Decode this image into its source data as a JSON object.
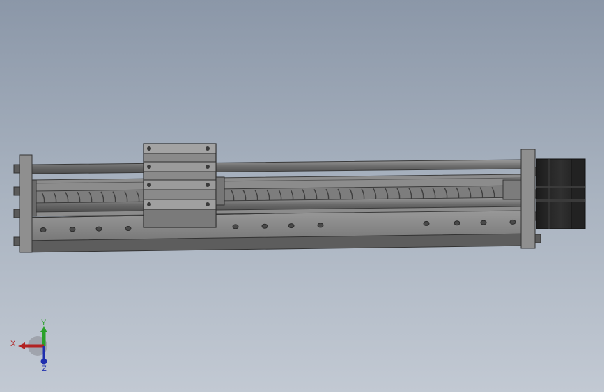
{
  "viewport": {
    "background_top": "#8b97a8",
    "background_bottom": "#c2c9d3"
  },
  "model": {
    "part_color": "#8e8e8e",
    "part_dark": "#4a4a4a",
    "motor_color": "#262626",
    "rod_color": "#7a7a7a"
  },
  "triad": {
    "x_label": "X",
    "y_label": "Y",
    "z_label": "Z",
    "x_color": "#b22222",
    "y_color": "#2aa12a",
    "z_color": "#1f2fae"
  }
}
